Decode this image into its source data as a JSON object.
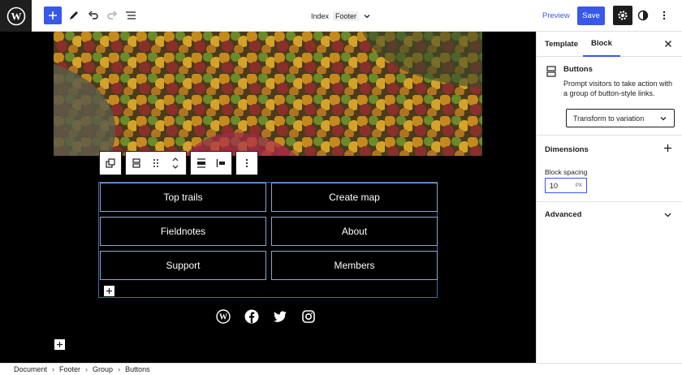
{
  "header": {
    "doc_title": "Index",
    "doc_template": "Footer",
    "preview_label": "Preview",
    "save_label": "Save",
    "icons": [
      "wordpress-logo-icon",
      "plus-icon",
      "pencil-icon",
      "undo-icon",
      "redo-icon",
      "list-view-icon",
      "chevron-down-icon",
      "gear-icon",
      "contrast-icon",
      "more-vertical-icon"
    ]
  },
  "canvas": {
    "buttons": [
      "Top trails",
      "Create map",
      "Fieldnotes",
      "About",
      "Support",
      "Members"
    ],
    "social_icons": [
      "wordpress-icon",
      "facebook-icon",
      "twitter-icon",
      "instagram-icon"
    ]
  },
  "sidebar": {
    "tabs": [
      "Template",
      "Block"
    ],
    "active_tab": "Block",
    "block_name": "Buttons",
    "block_description": "Prompt visitors to take action with a group of button-style links.",
    "transform_label": "Transform to variation",
    "dimensions_title": "Dimensions",
    "spacing_label": "Block spacing",
    "spacing_value": "10",
    "spacing_unit": "PX",
    "advanced_title": "Advanced"
  },
  "breadcrumb": [
    "Document",
    "Footer",
    "Group",
    "Buttons"
  ],
  "colors": {
    "accent": "#3858e9",
    "canvas_bg": "#000000",
    "button_border": "#8aa7c8"
  }
}
